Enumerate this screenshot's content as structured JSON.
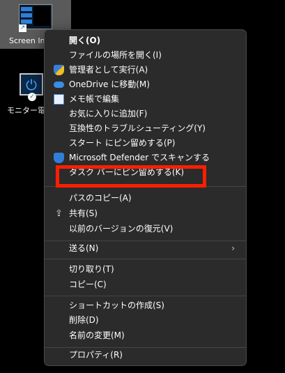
{
  "desktop": {
    "icon1_label": "Screen In",
    "icon2_label": "モニター電源"
  },
  "menu": {
    "items": [
      {
        "label": "開く(O)",
        "icon": ""
      },
      {
        "label": "ファイルの場所を開く(I)",
        "icon": ""
      },
      {
        "label": "管理者として実行(A)",
        "icon": "uac-shield-icon"
      },
      {
        "label": "OneDrive に移動(M)",
        "icon": "onedrive-cloud-icon"
      },
      {
        "label": "メモ帳で編集",
        "icon": "notepad-icon"
      },
      {
        "label": "お気に入りに追加(F)",
        "icon": ""
      },
      {
        "label": "互換性のトラブルシューティング(Y)",
        "icon": ""
      },
      {
        "label": "スタート にピン留めする(P)",
        "icon": ""
      },
      {
        "label": "Microsoft Defender でスキャンする",
        "icon": "defender-shield-icon"
      },
      {
        "label": "タスク バーにピン留めする(K)",
        "icon": ""
      },
      {
        "label": "パスのコピー(A)",
        "icon": ""
      },
      {
        "label": "共有(S)",
        "icon": "share-icon"
      },
      {
        "label": "以前のバージョンの復元(V)",
        "icon": ""
      },
      {
        "label": "送る(N)",
        "icon": "chevron-right-icon"
      },
      {
        "label": "切り取り(T)",
        "icon": ""
      },
      {
        "label": "コピー(C)",
        "icon": ""
      },
      {
        "label": "ショートカットの作成(S)",
        "icon": ""
      },
      {
        "label": "削除(D)",
        "icon": ""
      },
      {
        "label": "名前の変更(M)",
        "icon": ""
      },
      {
        "label": "プロパティ(R)",
        "icon": ""
      }
    ],
    "submenu_arrow": "›"
  },
  "highlight_color": "#ff1e00"
}
